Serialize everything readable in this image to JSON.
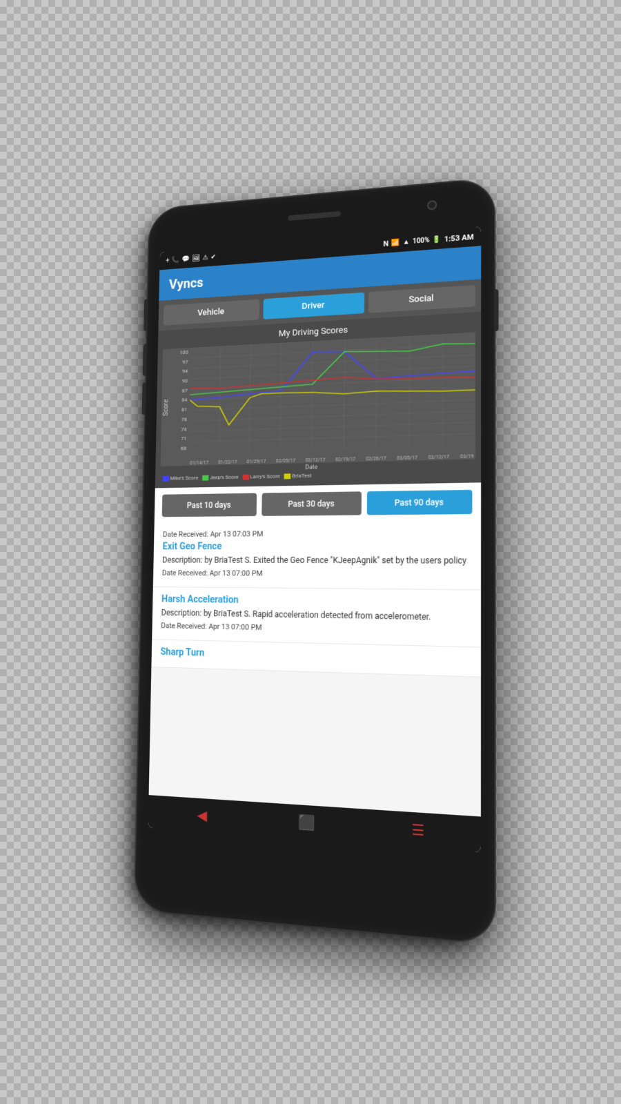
{
  "status_bar": {
    "time": "1:53 AM",
    "battery": "100%",
    "icons_left": [
      "+",
      "📶",
      "💬",
      "🖼",
      "⚠",
      "✔"
    ],
    "icons_right": [
      "N",
      "📶",
      "🔋"
    ]
  },
  "app": {
    "title": "Vyncs"
  },
  "tabs": [
    {
      "id": "vehicle",
      "label": "Vehicle",
      "active": false
    },
    {
      "id": "driver",
      "label": "Driver",
      "active": true
    },
    {
      "id": "social",
      "label": "Social",
      "active": false
    }
  ],
  "chart": {
    "title": "My Driving Scores",
    "y_label": "Score",
    "x_label": "Date",
    "y_axis": [
      "100",
      "97",
      "94",
      "90",
      "87",
      "84",
      "81",
      "78",
      "74",
      "71",
      "68"
    ],
    "x_axis": [
      "01/14/17",
      "01/22/17",
      "01/29/17",
      "02/05/17",
      "02/12/17",
      "02/19/17",
      "02/26/17",
      "03/05/17",
      "03/12/17",
      "03/19"
    ],
    "legend": [
      {
        "label": "Mike's Score",
        "color": "#3333cc"
      },
      {
        "label": "Jeep's Score",
        "color": "#33cc33"
      },
      {
        "label": "Larry's Score",
        "color": "#cc3333"
      },
      {
        "label": "BriaTest",
        "color": "#cccc00"
      }
    ]
  },
  "time_filters": [
    {
      "id": "10days",
      "label": "Past 10 days",
      "active": false
    },
    {
      "id": "30days",
      "label": "Past 30 days",
      "active": false
    },
    {
      "id": "90days",
      "label": "Past 90 days",
      "active": true
    }
  ],
  "alerts": [
    {
      "id": "exit-geo-fence",
      "date_received": "Date Received: Apr 13 07:03 PM",
      "title": "Exit Geo Fence",
      "description": "Description: by BriaTest S. Exited the Geo Fence \"KJeepAgnik\" set by the users policy",
      "second_date": "Date Received: Apr 13 07:00 PM"
    },
    {
      "id": "harsh-acceleration",
      "date_received": "Date Received: Apr 13 07:00 PM",
      "title": "Harsh Acceleration",
      "description": "Description: by BriaTest S. Rapid acceleration detected from accelerometer.",
      "second_date": "Date Received: Apr 13 07:00 PM"
    },
    {
      "id": "sharp-turn",
      "title": "Sharp Turn",
      "description": "",
      "date_received": ""
    }
  ],
  "nav": {
    "back": "◀",
    "home": "⬛",
    "menu": "☰"
  },
  "colors": {
    "header_bg": "#2b82c9",
    "tab_active": "#2b9fda",
    "tab_inactive": "#666666",
    "alert_title": "#2b9fda",
    "chart_bg": "#4a4a4a",
    "chart_plot_bg": "#5a5a5a"
  }
}
